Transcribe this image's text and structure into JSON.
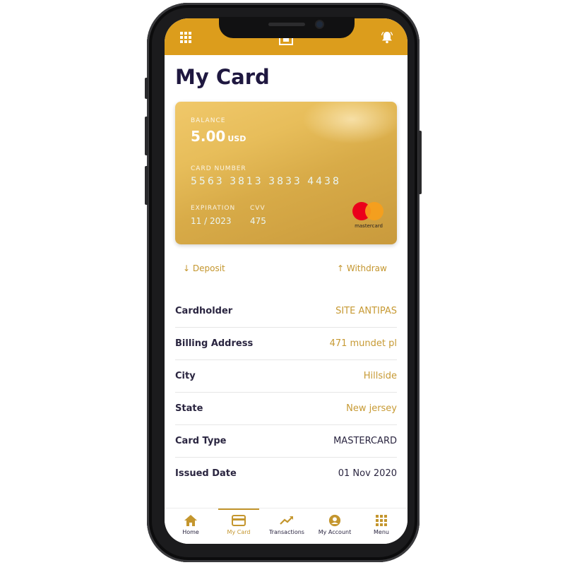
{
  "colors": {
    "accent": "#dc9d1c",
    "gold_text": "#c79a34",
    "title": "#1f1840"
  },
  "header": {
    "left_icon": "grid-icon",
    "center_icon": "card-frame-icon",
    "right_icon": "bell-icon"
  },
  "page": {
    "title": "My Card"
  },
  "card": {
    "balance_label": "BALANCE",
    "balance_value": "5.00",
    "balance_currency": "USD",
    "number_label": "CARD NUMBER",
    "number": "5563 3813 3833 4438",
    "expiration_label": "EXPIRATION",
    "expiration": "11 / 2023",
    "cvv_label": "CVV",
    "cvv": "475",
    "brand_text": "mastercard"
  },
  "actions": {
    "deposit": "Deposit",
    "withdraw": "Withdraw"
  },
  "details": [
    {
      "label": "Cardholder",
      "value": "SITE ANTIPAS"
    },
    {
      "label": "Billing Address",
      "value": "471 mundet pl"
    },
    {
      "label": "City",
      "value": "Hillside"
    },
    {
      "label": "State",
      "value": "New jersey"
    },
    {
      "label": "Card Type",
      "value": "MASTERCARD"
    },
    {
      "label": "Issued Date",
      "value": "01 Nov 2020"
    }
  ],
  "nav": [
    {
      "label": "Home",
      "icon": "home-icon"
    },
    {
      "label": "My Card",
      "icon": "card-icon",
      "active": true
    },
    {
      "label": "Transactions",
      "icon": "trend-icon"
    },
    {
      "label": "My Account",
      "icon": "account-icon"
    },
    {
      "label": "Menu",
      "icon": "menu-grid-icon"
    }
  ]
}
